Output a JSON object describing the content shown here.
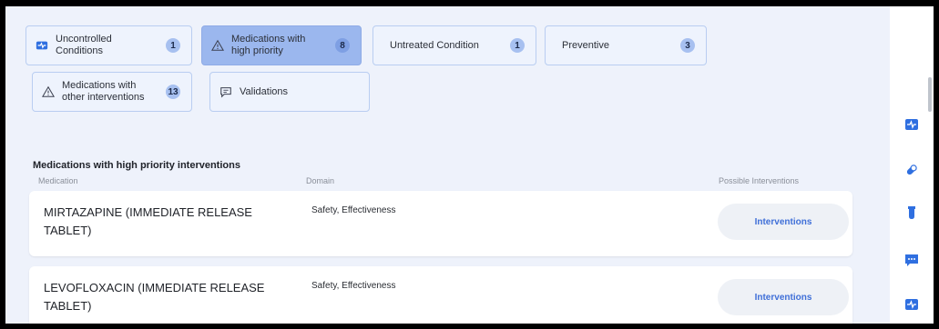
{
  "filters": {
    "row1": [
      {
        "label": "Uncontrolled\nConditions",
        "count": "1",
        "icon": "monitor-pulse-icon",
        "active": false
      },
      {
        "label": "Medications with\nhigh priority",
        "count": "8",
        "icon": "warning-triangle-icon",
        "active": true
      },
      {
        "label": "Untreated Condition",
        "count": "1",
        "icon": "",
        "active": false
      },
      {
        "label": "Preventive",
        "count": "3",
        "icon": "",
        "active": false
      }
    ],
    "row2": [
      {
        "label": "Medications with\nother interventions",
        "count": "13",
        "icon": "warning-triangle-icon"
      },
      {
        "label": "Validations",
        "icon": "comment-icon"
      }
    ]
  },
  "section": {
    "title": "Medications with high priority interventions",
    "columns": {
      "medication": "Medication",
      "domain": "Domain",
      "interventions": "Possible Interventions"
    }
  },
  "rows": [
    {
      "medication": "MIRTAZAPINE (IMMEDIATE RELEASE TABLET)",
      "domain": "Safety, Effectiveness",
      "button": "Interventions"
    },
    {
      "medication": "LEVOFLOXACIN (IMMEDIATE RELEASE TABLET)",
      "domain": "Safety, Effectiveness",
      "button": "Interventions"
    }
  ],
  "rail": {
    "icons": [
      "vitals-monitor-icon",
      "pill-icon",
      "test-tube-icon",
      "chat-icon",
      "vitals-monitor-icon"
    ]
  },
  "colors": {
    "accent": "#2f6fe0",
    "chip_active": "#9bb7ee",
    "background": "#eef2fb"
  }
}
